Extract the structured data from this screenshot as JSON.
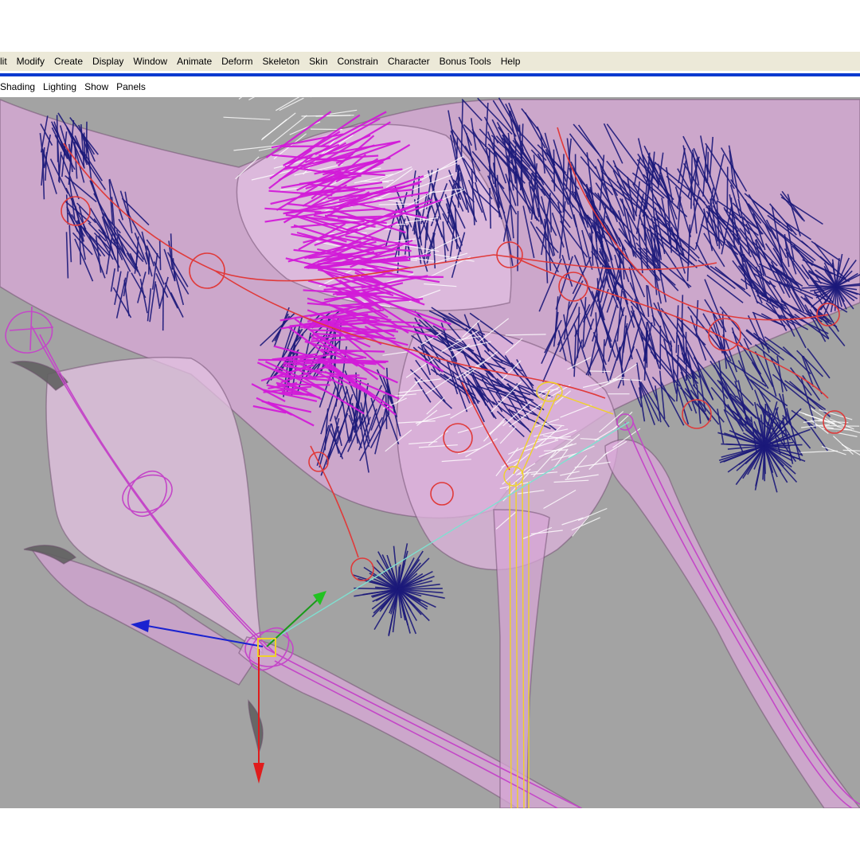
{
  "menu": {
    "items": [
      "lit",
      "Modify",
      "Create",
      "Display",
      "Window",
      "Animate",
      "Deform",
      "Skeleton",
      "Skin",
      "Constrain",
      "Character",
      "Bonus Tools",
      "Help"
    ]
  },
  "panel_menu": {
    "items": [
      "Shading",
      "Lighting",
      "Show",
      "Panels"
    ]
  },
  "colors": {
    "menubar_bg": "#ece9d8",
    "viewport_bg": "#a3a3a3",
    "skin": "#d9a8d8",
    "fur_dark": "#1c1a7a",
    "fur_magenta": "#d21bd8",
    "joint_red": "#e03a3a",
    "joint_magenta": "#c447c8",
    "joint_yellow": "#f0d228",
    "manip_x": "#e01c1c",
    "manip_y": "#1a9a1a",
    "manip_z": "#1a22d0"
  },
  "icons": {
    "move_manipulator": "move-manipulator-icon"
  }
}
